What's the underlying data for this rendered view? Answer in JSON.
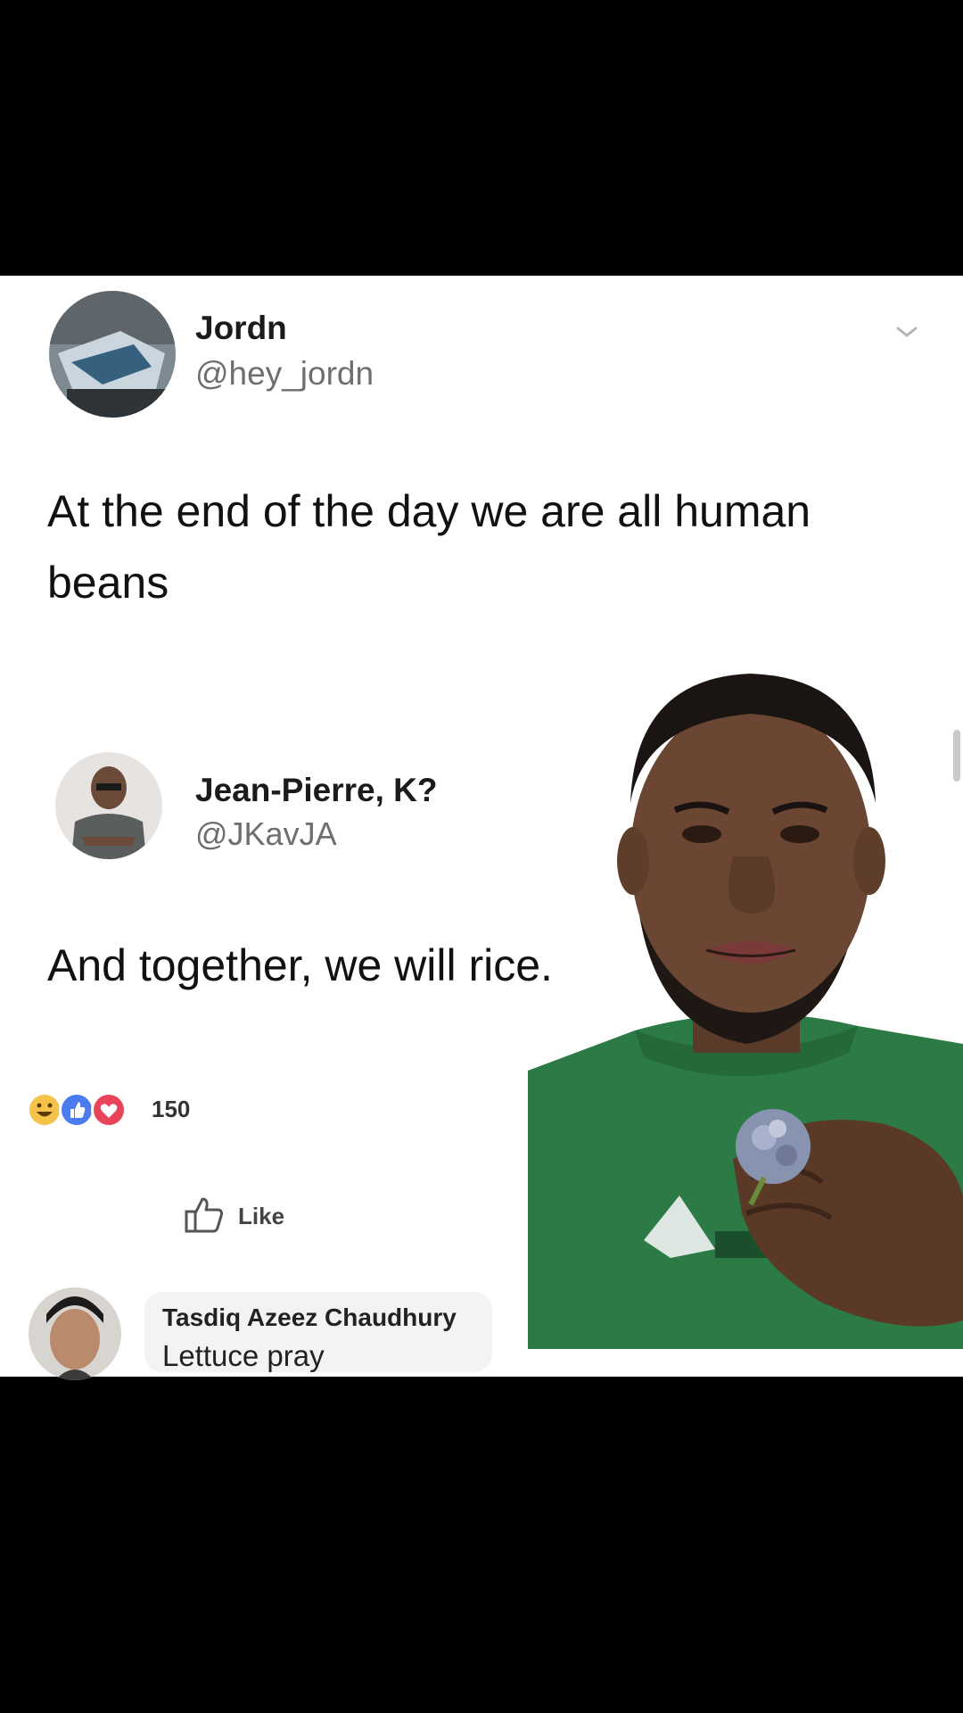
{
  "post": {
    "author_name": "Jordn",
    "author_handle": "@hey_jordn",
    "text": "At the end of the day we are all human beans"
  },
  "reply": {
    "author_name": "Jean-Pierre, K?",
    "author_handle": "@JKavJA",
    "text": "And together, we will rice."
  },
  "reactions": {
    "icons": [
      "haha-icon",
      "like-icon",
      "love-icon"
    ],
    "count": "150"
  },
  "actions": {
    "like_label": "Like"
  },
  "comment": {
    "author_name": "Tasdiq Azeez Chaudhury",
    "text": "Lettuce pray"
  },
  "colors": {
    "background": "#000000",
    "card": "#ffffff",
    "like_blue": "#4a7cf0",
    "love_red": "#e8455a",
    "haha_yellow": "#f5c24a",
    "shirt_green": "#2c7a45"
  }
}
